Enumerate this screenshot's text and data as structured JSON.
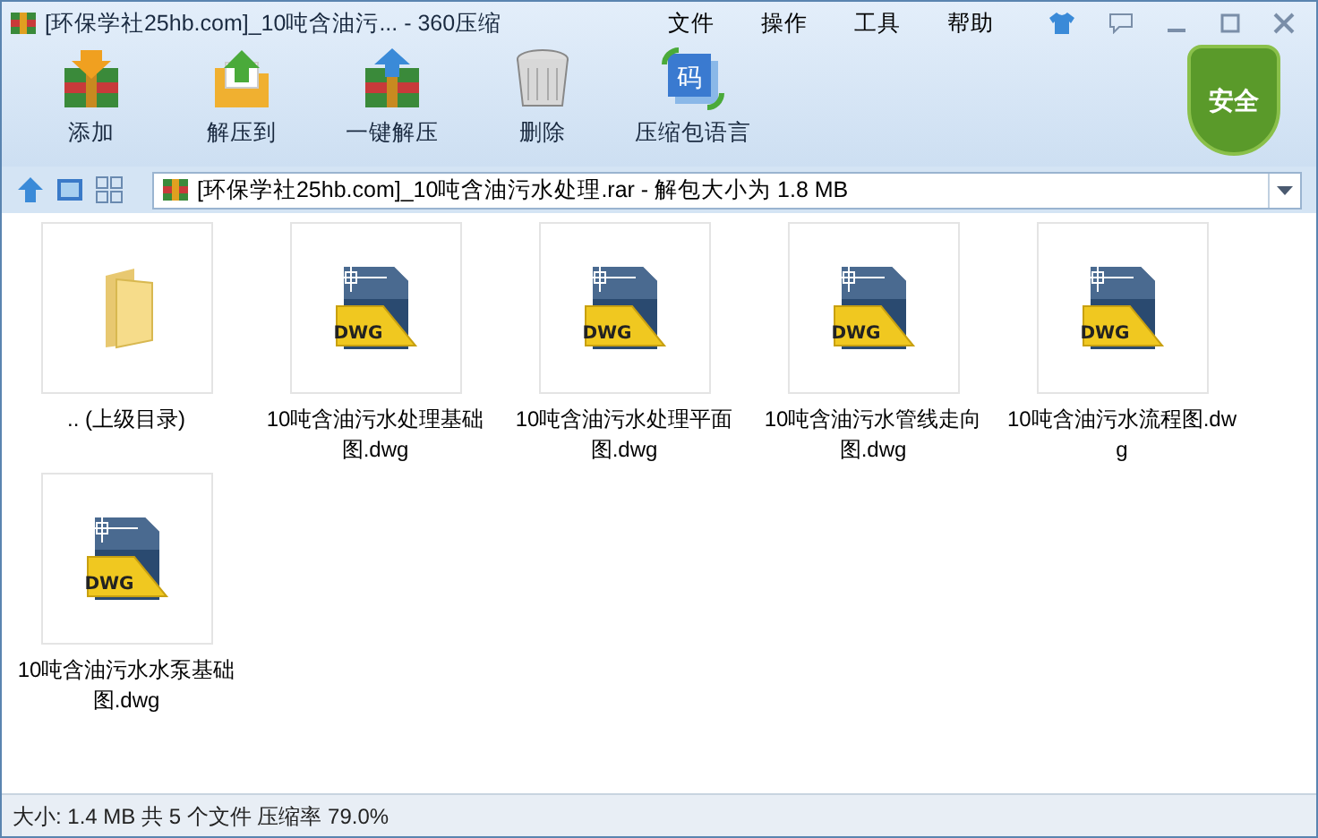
{
  "window": {
    "title": "[环保学社25hb.com]_10吨含油污... - 360压缩"
  },
  "menu": [
    "文件",
    "操作",
    "工具",
    "帮助"
  ],
  "toolbar": [
    {
      "label": "添加",
      "kind": "add"
    },
    {
      "label": "解压到",
      "kind": "extract"
    },
    {
      "label": "一键解压",
      "kind": "oneclick"
    },
    {
      "label": "删除",
      "kind": "delete"
    },
    {
      "label": "压缩包语言",
      "kind": "language",
      "icon_text": "码"
    }
  ],
  "security_badge": "安全",
  "address": {
    "value": "[环保学社25hb.com]_10吨含油污水处理.rar - 解包大小为 1.8 MB"
  },
  "files": [
    {
      "kind": "folder",
      "name": ".. (上级目录)"
    },
    {
      "kind": "dwg",
      "name": "10吨含油污水处理基础图.dwg",
      "badge": "DWG"
    },
    {
      "kind": "dwg",
      "name": "10吨含油污水处理平面图.dwg",
      "badge": "DWG"
    },
    {
      "kind": "dwg",
      "name": "10吨含油污水管线走向图.dwg",
      "badge": "DWG"
    },
    {
      "kind": "dwg",
      "name": "10吨含油污水流程图.dwg",
      "badge": "DWG"
    },
    {
      "kind": "dwg",
      "name": "10吨含油污水水泵基础图.dwg",
      "badge": "DWG"
    }
  ],
  "status_bar": "大小: 1.4 MB 共 5 个文件 压缩率 79.0%"
}
